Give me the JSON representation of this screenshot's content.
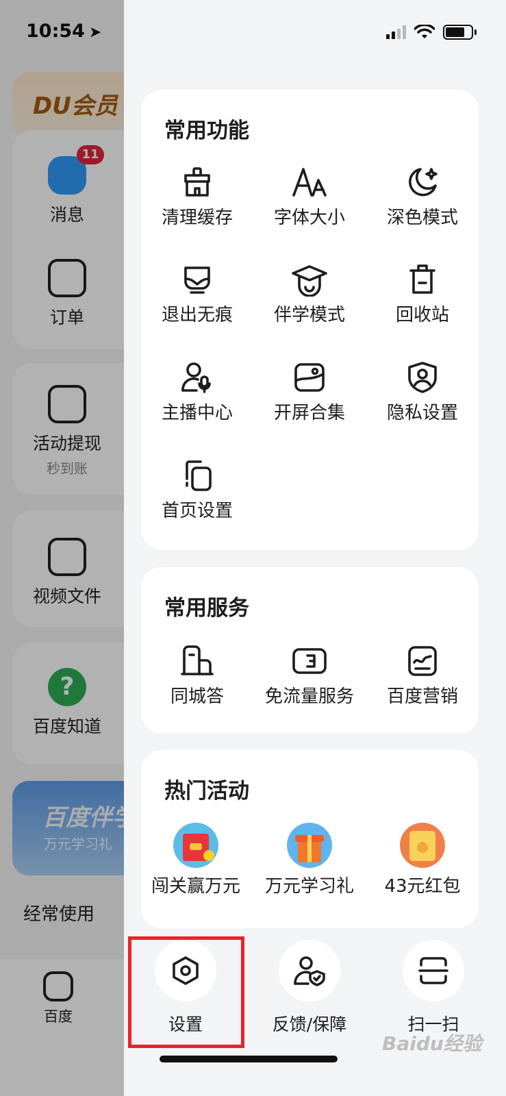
{
  "status": {
    "time": "10:54",
    "battery_level": 0.75
  },
  "background": {
    "vip_label": "DU会员",
    "message_badge": "11",
    "items": [
      {
        "label": "消息",
        "icon": "message-icon"
      },
      {
        "label": "订单",
        "icon": "order-icon"
      },
      {
        "label": "活动提现",
        "sub": "秒到账",
        "icon": "withdraw-icon"
      },
      {
        "label": "视频文件",
        "icon": "video-upload-icon"
      },
      {
        "label": "百度知道",
        "icon": "question-icon"
      }
    ],
    "banner_title": "百度伴学",
    "banner_sub": "万元学习礼",
    "section_title": "经常使用",
    "tab_home_label": "百度"
  },
  "drawer": {
    "common_functions": {
      "title": "常用功能",
      "items": [
        {
          "label": "清理缓存",
          "icon": "broom-icon"
        },
        {
          "label": "字体大小",
          "icon": "font-size-icon"
        },
        {
          "label": "深色模式",
          "icon": "moon-icon"
        },
        {
          "label": "退出无痕",
          "icon": "incognito-mask-icon"
        },
        {
          "label": "伴学模式",
          "icon": "graduation-cap-icon"
        },
        {
          "label": "回收站",
          "icon": "trash-icon"
        },
        {
          "label": "主播中心",
          "icon": "streamer-mic-icon"
        },
        {
          "label": "开屏合集",
          "icon": "image-gallery-icon"
        },
        {
          "label": "隐私设置",
          "icon": "privacy-shield-icon"
        },
        {
          "label": "首页设置",
          "icon": "homepage-settings-icon"
        }
      ]
    },
    "common_services": {
      "title": "常用服务",
      "items": [
        {
          "label": "同城答",
          "icon": "building-icon"
        },
        {
          "label": "免流量服务",
          "icon": "sim-card-icon"
        },
        {
          "label": "百度营销",
          "icon": "marketing-chart-icon"
        }
      ]
    },
    "hot_activities": {
      "title": "热门活动",
      "items": [
        {
          "label": "闯关赢万元",
          "icon": "red-envelope-icon"
        },
        {
          "label": "万元学习礼",
          "icon": "gift-box-icon"
        },
        {
          "label": "43元红包",
          "icon": "gold-envelope-icon"
        }
      ]
    },
    "bottom_bar": [
      {
        "label": "设置",
        "icon": "settings-hexagon-icon"
      },
      {
        "label": "反馈/保障",
        "icon": "feedback-shield-icon"
      },
      {
        "label": "扫一扫",
        "icon": "scan-icon"
      }
    ]
  },
  "watermark": "Baidu经验"
}
